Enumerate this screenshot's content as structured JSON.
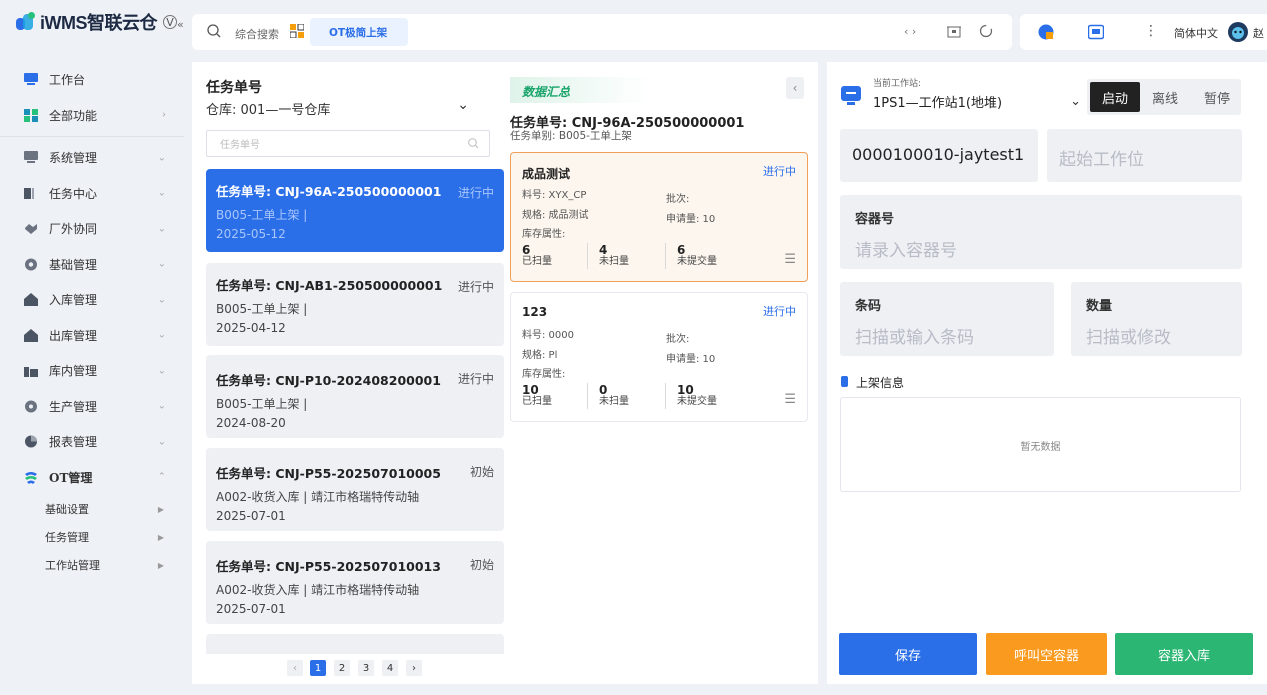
{
  "app": {
    "logo_text": "iWMS智联云仓",
    "logo_badge": "V",
    "collapse": "«"
  },
  "sidebar": {
    "items": [
      {
        "label": "工作台",
        "icon": "monitor-icon",
        "color": "#2a6ee8"
      },
      {
        "label": "全部功能",
        "icon": "apps-icon",
        "color": "#1e9e8a"
      },
      {
        "label": "系统管理",
        "icon": "system-icon",
        "color": "#6b7280"
      },
      {
        "label": "任务中心",
        "icon": "task-icon",
        "color": "#4b5563"
      },
      {
        "label": "厂外协同",
        "icon": "handshake-icon",
        "color": "#6b7280"
      },
      {
        "label": "基础管理",
        "icon": "gear-icon",
        "color": "#6b7280"
      },
      {
        "label": "入库管理",
        "icon": "inbound-icon",
        "color": "#4b5563"
      },
      {
        "label": "出库管理",
        "icon": "outbound-icon",
        "color": "#4b5563"
      },
      {
        "label": "库内管理",
        "icon": "warehouse-icon",
        "color": "#4b5563"
      },
      {
        "label": "生产管理",
        "icon": "production-icon",
        "color": "#6b7280"
      },
      {
        "label": "报表管理",
        "icon": "report-icon",
        "color": "#4b5563"
      },
      {
        "label": "OT管理",
        "icon": "ot-icon",
        "color": "#2a6ee8"
      }
    ],
    "sub_items": [
      {
        "label": "基础设置"
      },
      {
        "label": "任务管理"
      },
      {
        "label": "工作站管理"
      }
    ]
  },
  "topbar": {
    "search_placeholder": "综合搜索",
    "tab": "OT极简上架",
    "lang": "简体中文",
    "user_initial": "赵"
  },
  "left": {
    "title": "任务单号",
    "warehouse": "仓库: 001—一号仓库",
    "search_placeholder": "任务单号",
    "tasks": [
      {
        "no": "任务单号: CNJ-96A-250500000001",
        "status": "进行中",
        "type": "B005-工单上架 |",
        "date": "2025-05-12"
      },
      {
        "no": "任务单号: CNJ-AB1-250500000001",
        "status": "进行中",
        "type": "B005-工单上架 |",
        "date": "2025-04-12"
      },
      {
        "no": "任务单号: CNJ-P10-202408200001",
        "status": "进行中",
        "type": "B005-工单上架 |",
        "date": "2024-08-20"
      },
      {
        "no": "任务单号: CNJ-P55-202507010005",
        "status": "初始",
        "type": "A002-收货入库 | 靖江市格瑞特传动轴",
        "date": "2025-07-01"
      },
      {
        "no": "任务单号: CNJ-P55-202507010013",
        "status": "初始",
        "type": "A002-收货入库 | 靖江市格瑞特传动轴",
        "date": "2025-07-01"
      }
    ],
    "pages": [
      "1",
      "2",
      "3",
      "4"
    ],
    "current_page": "1"
  },
  "middle": {
    "summary_tag": "数据汇总",
    "task_no": "任务单号: CNJ-96A-250500000001",
    "task_type": "任务单别: B005-工单上架",
    "cards": [
      {
        "name": "成品测试",
        "status": "进行中",
        "item_no": "料号: XYX_CP",
        "batch": "批次:",
        "spec": "规格: 成品测试",
        "req": "申请量: 10",
        "attr": "库存属性:",
        "scanned": "6",
        "scanned_label": "已扫量",
        "unscanned": "4",
        "unscanned_label": "未扫量",
        "unsubmitted": "6",
        "unsubmitted_label": "未提交量"
      },
      {
        "name": "123",
        "status": "进行中",
        "item_no": "料号: 0000",
        "batch": "批次:",
        "spec": "规格: Pl",
        "req": "申请量: 10",
        "attr": "库存属性:",
        "scanned": "10",
        "scanned_label": "已扫量",
        "unscanned": "0",
        "unscanned_label": "未扫量",
        "unsubmitted": "10",
        "unsubmitted_label": "未提交量"
      }
    ]
  },
  "right": {
    "station_label": "当前工作站:",
    "station": "1PS1—工作站1(地堆)",
    "btn_start": "启动",
    "btn_offline": "离线",
    "btn_pause": "暂停",
    "location_value": "0000100010-jaytest1",
    "start_placeholder": "起始工作位",
    "container_label": "容器号",
    "container_placeholder": "请录入容器号",
    "barcode_label": "条码",
    "barcode_placeholder": "扫描或输入条码",
    "qty_label": "数量",
    "qty_placeholder": "扫描或修改",
    "shelf_info": "上架信息",
    "empty": "暂无数据",
    "save": "保存",
    "call_empty": "呼叫空容器",
    "container_inbound": "容器入库"
  },
  "colors": {
    "primary": "#2a6ee8",
    "orange": "#fa9a1e",
    "green": "#2bb673",
    "dark": "#222222"
  }
}
